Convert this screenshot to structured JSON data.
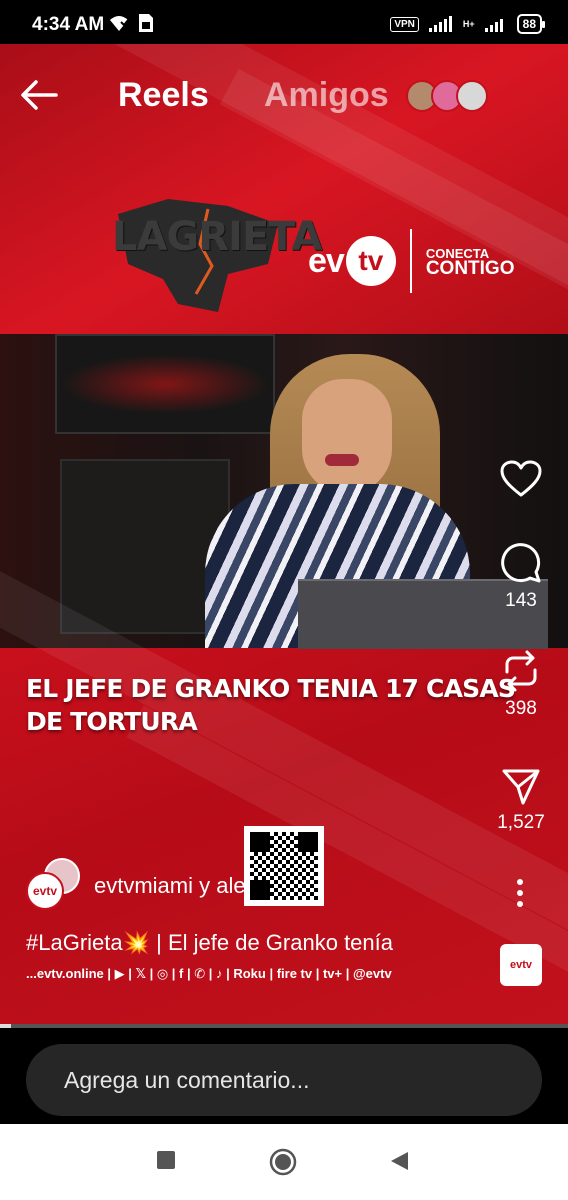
{
  "status_bar": {
    "time": "4:34 AM",
    "vpn": "VPN",
    "network": "H+",
    "battery": "88"
  },
  "nav": {
    "reels_label": "Reels",
    "friends_label": "Amigos"
  },
  "video": {
    "show_logo": "LAGRIETA",
    "channel_logo_ev": "ev",
    "channel_logo_tv": "tv",
    "tagline_top": "CONECTA",
    "tagline_bottom": "CONTIGO",
    "headline": "EL JEFE DE GRANKO TENIA 17 CASAS DE TORTURA",
    "social_strip": "...evtv.online | ▶ | 𝕏 | ◎ | f | ✆ | ♪ | Roku | fire tv | tv+ | @evtv"
  },
  "actions": {
    "likes": "",
    "comments": "143",
    "shares": "398",
    "sends": "1,527"
  },
  "post": {
    "author": "evtvmiami y alejapola",
    "caption_tag": "#LaGrieta",
    "caption_emoji": "💥",
    "caption_text": " | El jefe de Granko tenía",
    "avatar_logo": "evtv"
  },
  "comment": {
    "placeholder": "Agrega un comentario..."
  },
  "colors": {
    "brand_red": "#c4101c",
    "background": "#000000"
  }
}
